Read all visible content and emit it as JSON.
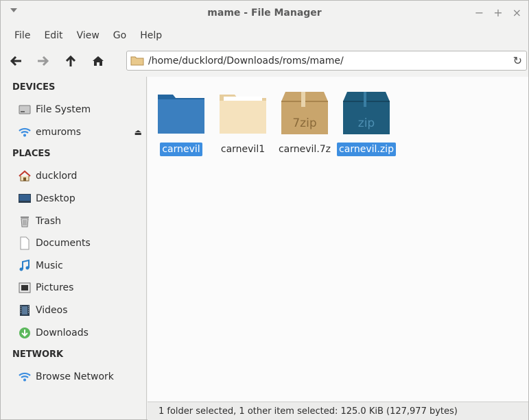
{
  "window": {
    "title": "mame - File Manager",
    "controls": {
      "minimize": "−",
      "maximize": "+",
      "close": "×"
    }
  },
  "menubar": {
    "items": [
      "File",
      "Edit",
      "View",
      "Go",
      "Help"
    ]
  },
  "toolbar": {
    "address": "/home/ducklord/Downloads/roms/mame/",
    "reload": "↻"
  },
  "sidebar": {
    "devices_header": "DEVICES",
    "devices": [
      {
        "label": "File System"
      },
      {
        "label": "emuroms",
        "eject": "⏏"
      }
    ],
    "places_header": "PLACES",
    "places": [
      {
        "label": "ducklord"
      },
      {
        "label": "Desktop"
      },
      {
        "label": "Trash"
      },
      {
        "label": "Documents"
      },
      {
        "label": "Music"
      },
      {
        "label": "Pictures"
      },
      {
        "label": "Videos"
      },
      {
        "label": "Downloads"
      }
    ],
    "network_header": "NETWORK",
    "network": [
      {
        "label": "Browse Network"
      }
    ]
  },
  "files": [
    {
      "name": "carnevil",
      "type": "folder",
      "selected": true
    },
    {
      "name": "carnevil1",
      "type": "folder-light",
      "selected": false
    },
    {
      "name": "carnevil.7z",
      "type": "archive-7z",
      "badge": "7zip",
      "selected": false
    },
    {
      "name": "carnevil.zip",
      "type": "archive-zip",
      "badge": "zip",
      "selected": true
    }
  ],
  "statusbar": {
    "text": "1 folder selected, 1 other item selected: 125.0 KiB (127,977 bytes)"
  },
  "colors": {
    "selection": "#3d8ee0",
    "folder_blue": "#2f6fa6",
    "folder_light": "#f3dfb9",
    "archive_7z": "#c7a36b",
    "archive_zip": "#1f5f7e"
  }
}
